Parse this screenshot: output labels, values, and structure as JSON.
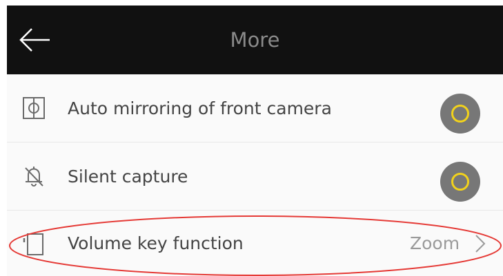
{
  "header": {
    "title": "More",
    "back_icon": "back-arrow-icon"
  },
  "settings": {
    "items": [
      {
        "icon": "mirror-icon",
        "label": "Auto mirroring of front camera",
        "control": "toggle",
        "toggle_color": "#777777",
        "ring_color": "#f2d21b"
      },
      {
        "icon": "bell-off-icon",
        "label": "Silent capture",
        "control": "toggle",
        "toggle_color": "#777777",
        "ring_color": "#f2d21b"
      },
      {
        "icon": "device-icon",
        "label": "Volume key function",
        "control": "value",
        "value": "Zoom"
      }
    ]
  },
  "annotation": {
    "color": "#e53935"
  }
}
